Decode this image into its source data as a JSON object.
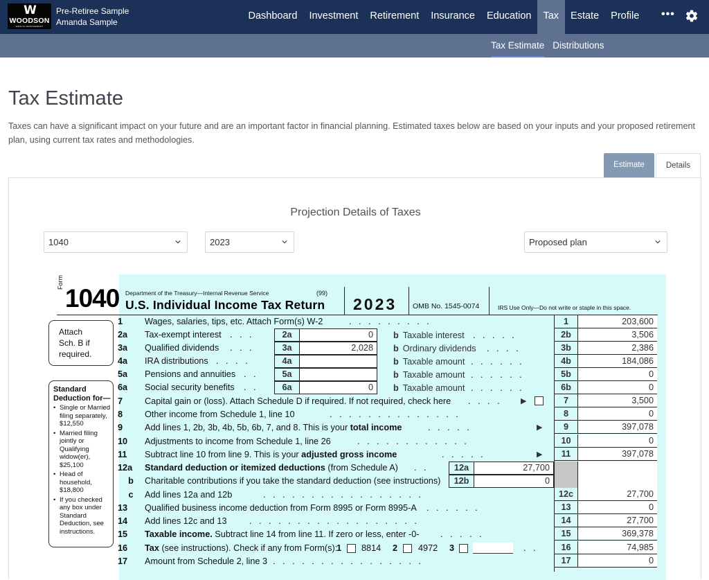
{
  "header": {
    "logo": {
      "mark": "W",
      "brand": "WOODSON",
      "tagline": "WEALTH MANAGEMENT"
    },
    "client": {
      "plan_name": "Pre-Retiree Sample",
      "client_name": "Amanda Sample"
    },
    "nav": [
      {
        "label": "Dashboard",
        "active": false
      },
      {
        "label": "Investment",
        "active": false
      },
      {
        "label": "Retirement",
        "active": false
      },
      {
        "label": "Insurance",
        "active": false
      },
      {
        "label": "Education",
        "active": false
      },
      {
        "label": "Tax",
        "active": true
      },
      {
        "label": "Estate",
        "active": false
      },
      {
        "label": "Profile",
        "active": false
      }
    ],
    "more_icon": "•••",
    "settings_icon": "gear-icon",
    "subnav": [
      {
        "label": "Tax Estimate",
        "active": true
      },
      {
        "label": "Distributions",
        "active": false
      }
    ]
  },
  "page": {
    "title": "Tax Estimate",
    "description": "Taxes can have a significant impact on your future and are an important factor in financial planning. Estimated taxes below are based on your inputs and your proposed retirement plan, using current tax rates and methodologies.",
    "tabs": [
      {
        "label": "Estimate",
        "active": true
      },
      {
        "label": "Details",
        "active": false
      }
    ]
  },
  "projection": {
    "title": "Projection Details of Taxes",
    "form_select": "1040",
    "year_select": "2023",
    "plan_select": "Proposed plan"
  },
  "form1040": {
    "form_word": "Form",
    "form_number": "1040",
    "department": "Department of the Treasury—Internal Revenue Service",
    "code_99": "(99)",
    "title": "U.S. Individual Income Tax Return",
    "year": "2023",
    "omb": "OMB No. 1545-0074",
    "irs_use": "IRS Use Only—Do not write or staple in this space.",
    "attach_note": [
      "Attach",
      "Sch. B if",
      "required."
    ],
    "std_deduction": {
      "heading": [
        "Standard",
        "Deduction for—"
      ],
      "items": [
        "Single or Married filing separately, $12,550",
        "Married filing jointly or Qualifying widow(er), $25,100",
        "Head of household, $18,800",
        "If you checked any box under Standard Deduction, see instructions."
      ]
    },
    "lines": {
      "l1": {
        "num": "1",
        "label": "Wages, salaries, tips, etc. Attach Form(s) W-2",
        "code": "1",
        "value": "203,600"
      },
      "l2a": {
        "num": "2a",
        "label": "Tax-exempt interest",
        "code": "2a",
        "value": "0"
      },
      "l2b": {
        "label": "Taxable interest",
        "code": "2b",
        "value": "3,506"
      },
      "l3a": {
        "num": "3a",
        "label": "Qualified dividends",
        "code": "3a",
        "value": "2,028"
      },
      "l3b": {
        "label": "Ordinary dividends",
        "code": "3b",
        "value": "2,386"
      },
      "l4a": {
        "num": "4a",
        "label": "IRA distributions",
        "code": "4a",
        "value": ""
      },
      "l4b": {
        "label": "Taxable amount",
        "code": "4b",
        "value": "184,086"
      },
      "l5a": {
        "num": "5a",
        "label": "Pensions and annuities",
        "code": "5a",
        "value": ""
      },
      "l5b": {
        "label": "Taxable amount",
        "code": "5b",
        "value": "0"
      },
      "l6a": {
        "num": "6a",
        "label": "Social security benefits",
        "code": "6a",
        "value": "0"
      },
      "l6b": {
        "label": "Taxable amount",
        "code": "6b",
        "value": "0"
      },
      "l7": {
        "num": "7",
        "label": "Capital gain or (loss). Attach Schedule D if required. If not required, check here",
        "code": "7",
        "value": "3,500"
      },
      "l8": {
        "num": "8",
        "label": "Other income from Schedule 1, line 10",
        "code": "8",
        "value": "0"
      },
      "l9": {
        "num": "9",
        "label_pre": "Add lines 1, 2b, 3b, 4b, 5b, 6b, 7, and 8. This is your ",
        "label_bold": "total income",
        "code": "9",
        "value": "397,078"
      },
      "l10": {
        "num": "10",
        "label": "Adjustments to income from Schedule 1, line 26",
        "code": "10",
        "value": "0"
      },
      "l11": {
        "num": "11",
        "label_pre": "Subtract line 10 from line 9. This is your ",
        "label_bold": "adjusted gross income",
        "code": "11",
        "value": "397,078"
      },
      "l12a": {
        "num": "12a",
        "label_bold": "Standard deduction or itemized deductions",
        "label_post": " (from Schedule A)",
        "code": "12a",
        "value": "27,700"
      },
      "l12b": {
        "num": "b",
        "label": "Charitable contributions if you take the standard deduction (see instructions)",
        "code": "12b",
        "value": "0"
      },
      "l12c": {
        "num": "c",
        "label": "Add lines 12a and 12b",
        "code": "12c",
        "value": "27,700"
      },
      "l13": {
        "num": "13",
        "label": "Qualified business income deduction from Form 8995 or Form 8995-A",
        "code": "13",
        "value": "0"
      },
      "l14": {
        "num": "14",
        "label": "Add lines 12c and 13",
        "code": "14",
        "value": "27,700"
      },
      "l15": {
        "num": "15",
        "label_bold": "Taxable income.",
        "label_post": " Subtract line 14 from line 11. If zero or less, enter -0-",
        "code": "15",
        "value": "369,378"
      },
      "l16": {
        "num": "16",
        "label_bold": "Tax",
        "label_post": " (see instructions). Check if any from Form(s):",
        "opt1_num": "1",
        "opt1": "8814",
        "opt2_num": "2",
        "opt2": "4972",
        "opt3_num": "3",
        "code": "16",
        "value": "74,985"
      },
      "l17": {
        "num": "17",
        "label": "Amount from Schedule 2, line 3",
        "code": "17",
        "value": "0"
      }
    },
    "b_prefix": "b"
  }
}
